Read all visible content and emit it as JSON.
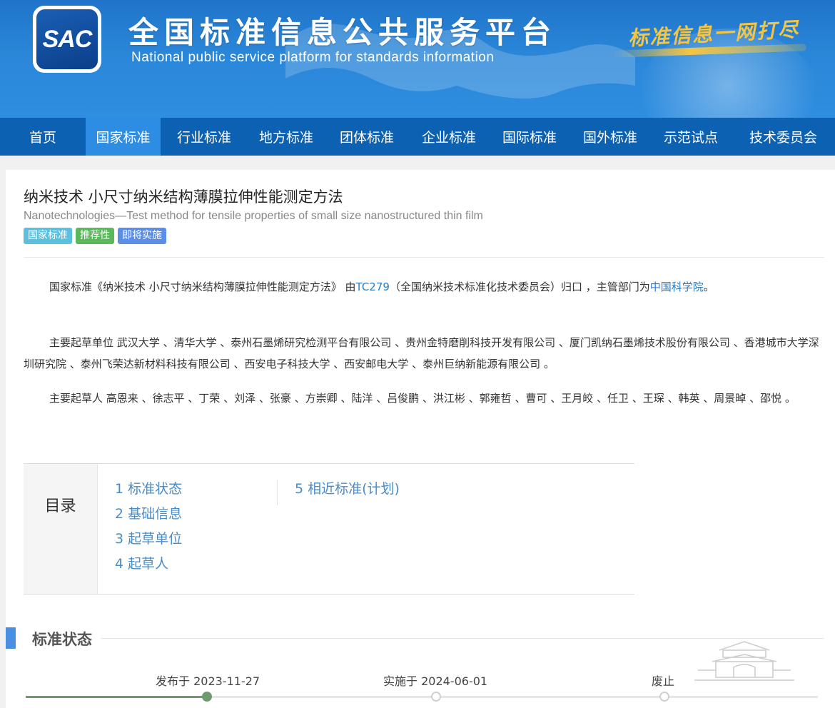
{
  "header": {
    "logo_text": "SAC",
    "title": "全国标准信息公共服务平台",
    "subtitle": "National public service platform  for standards information",
    "slogan": "标准信息一网打尽"
  },
  "nav": [
    {
      "label": "首页",
      "active": false
    },
    {
      "label": "国家标准",
      "active": true
    },
    {
      "label": "行业标准",
      "active": false
    },
    {
      "label": "地方标准",
      "active": false
    },
    {
      "label": "团体标准",
      "active": false
    },
    {
      "label": "企业标准",
      "active": false
    },
    {
      "label": "国际标准",
      "active": false
    },
    {
      "label": "国外标准",
      "active": false
    },
    {
      "label": "示范试点",
      "active": false
    },
    {
      "label": "技术委员会",
      "active": false
    }
  ],
  "standard": {
    "title_cn": "纳米技术 小尺寸纳米结构薄膜拉伸性能测定方法",
    "title_en": "Nanotechnologies—Test method for tensile properties of small size nanostructured thin film",
    "tags": [
      "国家标准",
      "推荐性",
      "即将实施"
    ]
  },
  "description": {
    "p1_prefix": "国家标准《纳米技术 小尺寸纳米结构薄膜拉伸性能测定方法》 由",
    "p1_tc_link": "TC279",
    "p1_middle": "（全国纳米技术标准化技术委员会）归口 ，主管部门为",
    "p1_dept_link": "中国科学院",
    "p1_suffix": "。",
    "p2": "主要起草单位 武汉大学 、清华大学 、泰州石墨烯研究检测平台有限公司 、贵州金特磨削科技开发有限公司 、厦门凯纳石墨烯技术股份有限公司 、香港城市大学深圳研究院 、泰州飞荣达新材料科技有限公司 、西安电子科技大学 、西安邮电大学 、泰州巨纳新能源有限公司 。",
    "p3": "主要起草人 高恩来 、徐志平 、丁荣 、刘泽 、张豪 、方崇卿 、陆洋 、吕俊鹏 、洪江彬 、郭雍哲 、曹可 、王月皎 、任卫 、王琛 、韩英 、周景晫 、邵悦 。"
  },
  "toc": {
    "label": "目录",
    "col1": [
      "1  标准状态",
      "2  基础信息",
      "3  起草单位",
      "4  起草人"
    ],
    "col2": [
      "5  相近标准(计划)"
    ]
  },
  "status_section": {
    "title": "标准状态",
    "progress_fraction": 0.23,
    "steps": [
      {
        "label": "发布于 2023-11-27",
        "done": true
      },
      {
        "label": "实施于 2024-06-01",
        "done": false
      },
      {
        "label": "废止",
        "done": false
      }
    ]
  }
}
